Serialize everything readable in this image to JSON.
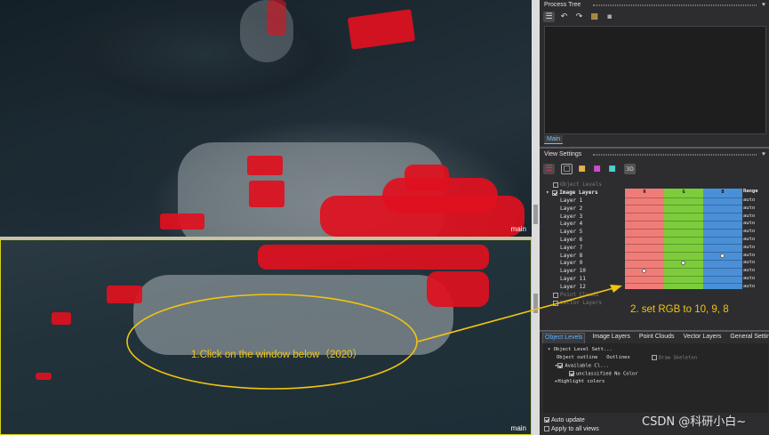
{
  "views": {
    "top_label": "main",
    "bottom_label": "main"
  },
  "process_tree": {
    "title": "Process Tree",
    "tab": "Main"
  },
  "view_settings": {
    "title": "View Settings",
    "three_d_label": "3D",
    "tree": {
      "object_levels": "Object Levels",
      "image_layers": "Image Layers",
      "layers": [
        "Layer 1",
        "Layer 2",
        "Layer 3",
        "Layer 4",
        "Layer 5",
        "Layer 6",
        "Layer 7",
        "Layer 8",
        "Layer 9",
        "Layer 10",
        "Layer 11",
        "Layer 12"
      ],
      "point_clouds": "Point Clouds",
      "vector_layers": "Vector Layers"
    },
    "columns": [
      "R",
      "G",
      "B"
    ],
    "range_header": "Range",
    "range_value": "auto",
    "selected": {
      "R": "Layer 10",
      "G": "Layer 9",
      "B": "Layer 8"
    },
    "colors": {
      "R": "#f07c78",
      "G": "#7ccc3c",
      "B": "#4a90d8"
    }
  },
  "bottom_tabs": [
    "Object Levels",
    "Image Layers",
    "Point Clouds",
    "Vector Layers",
    "General Settings"
  ],
  "object_levels_tree": {
    "row1": "Object Level Sett...",
    "row2_label": "Object outline",
    "row2_value": "Outlines",
    "row2_extra": "Draw Skeleton",
    "row3": "Available Cl...",
    "row4_label": "unclassified",
    "row4_value": "No Color",
    "row5": "Highlight colors"
  },
  "footer": {
    "auto_update": "Auto update",
    "apply_all": "Apply to all views"
  },
  "annotations": {
    "step1": "1.Click on the window below（2020）",
    "step2": "2. set RGB to 10, 9, 8",
    "accent": "#f1c40f"
  },
  "watermark": "CSDN @科研小白~"
}
